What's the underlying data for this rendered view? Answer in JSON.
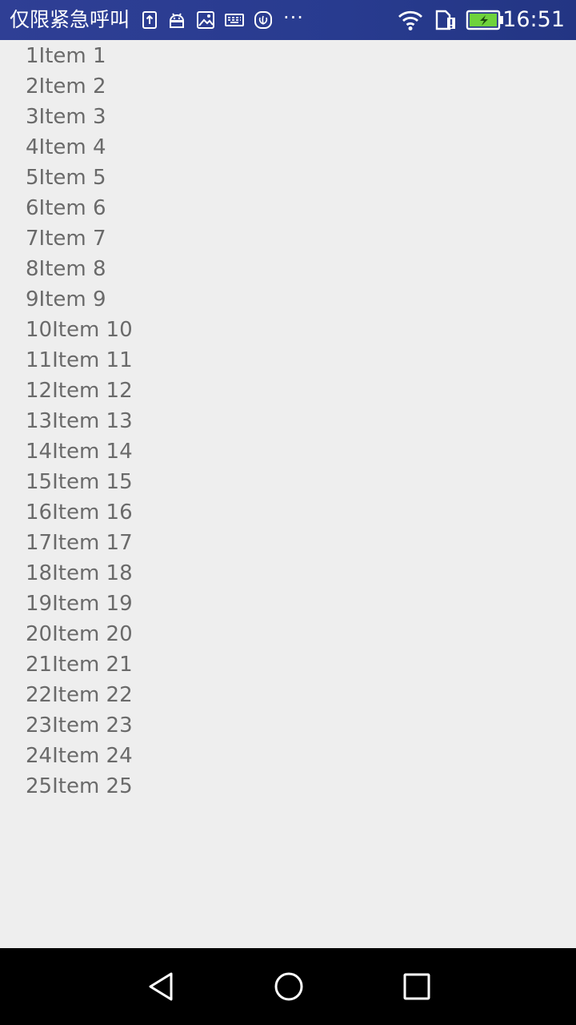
{
  "status_bar": {
    "carrier_text": "仅限紧急呼叫",
    "more_notifications": "···",
    "time": "16:51",
    "icons": [
      "upload-icon",
      "android-icon",
      "image-icon",
      "keyboard-icon",
      "huawei-icon",
      "wifi-icon",
      "sim-alert-icon",
      "battery-charging-icon"
    ],
    "battery_color": "#6fd23c",
    "background_color": "#2f3f95"
  },
  "list": {
    "items": [
      {
        "label": "1Item 1"
      },
      {
        "label": "2Item 2"
      },
      {
        "label": "3Item 3"
      },
      {
        "label": "4Item 4"
      },
      {
        "label": "5Item 5"
      },
      {
        "label": "6Item 6"
      },
      {
        "label": "7Item 7"
      },
      {
        "label": "8Item 8"
      },
      {
        "label": "9Item 9"
      },
      {
        "label": "10Item 10"
      },
      {
        "label": "11Item 11"
      },
      {
        "label": "12Item 12"
      },
      {
        "label": "13Item 13"
      },
      {
        "label": "14Item 14"
      },
      {
        "label": "15Item 15"
      },
      {
        "label": "16Item 16"
      },
      {
        "label": "17Item 17"
      },
      {
        "label": "18Item 18"
      },
      {
        "label": "19Item 19"
      },
      {
        "label": "20Item 20"
      },
      {
        "label": "21Item 21"
      },
      {
        "label": "22Item 22"
      },
      {
        "label": "23Item 23"
      },
      {
        "label": "24Item 24"
      },
      {
        "label": "25Item 25"
      }
    ]
  },
  "nav_bar": {
    "buttons": [
      "back-icon",
      "home-icon",
      "recents-icon"
    ]
  }
}
